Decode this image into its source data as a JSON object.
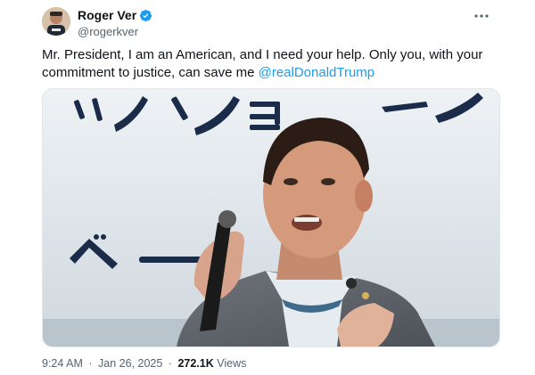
{
  "author": {
    "display_name": "Roger Ver",
    "handle": "@rogerkver",
    "verified_color": "#1d9bf0"
  },
  "tweet": {
    "text_before_mention": "Mr. President, I am an American, and I need your help. Only you, with your commitment to justice, can save me ",
    "mention": "@realDonaldTrump",
    "media_alt": "Man speaking into a microphone in front of a screen with Japanese katakana text"
  },
  "meta": {
    "time": "9:24 AM",
    "separator_dot": "·",
    "date": "Jan 26, 2025",
    "views_count": "272.1K",
    "views_label": "Views"
  },
  "icons": {
    "more": "more-horizontal-icon",
    "verified": "verified-badge-icon"
  },
  "colors": {
    "accent": "#1d9bf0",
    "secondary_text": "#536471",
    "primary_text": "#0f1419"
  }
}
